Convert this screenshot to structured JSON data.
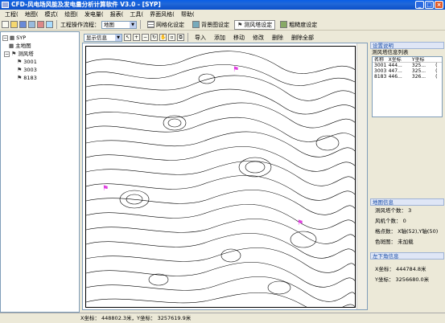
{
  "window": {
    "title": "CFD-风电场风能及发电量分析计算软件 V3.0 - [SYP]",
    "minimize": "_",
    "restore": "□",
    "close": "×"
  },
  "menu": [
    "工程(",
    "地图(",
    "模式(",
    "绘图(",
    "发电量(",
    "报表(",
    "工具(",
    "界面风格(",
    "帮助("
  ],
  "toolbar": {
    "process_label": "工程操作流程：",
    "process_value": "地图",
    "mesh_label": "网格化设定",
    "background_label": "背景图设定",
    "tower_label": "测风塔设定",
    "roughness_label": "粗糙度设定"
  },
  "tree": {
    "root": "SYP",
    "map": "主地图",
    "towers_group": "测风塔",
    "towers": [
      "3001",
      "3003",
      "8183"
    ]
  },
  "map_toolbar": {
    "display_label": "显示信息",
    "import": "导入",
    "add": "添加",
    "move": "移动",
    "edit": "修改",
    "delete": "删除",
    "delete_all": "删除全部"
  },
  "settings_panel": {
    "title": "设置说明",
    "list_title": "测风塔信息列表",
    "columns": [
      "名称",
      "X坐标",
      "Y坐标",
      ""
    ],
    "rows": [
      [
        "3001",
        "444...",
        "325...",
        "("
      ],
      [
        "3003",
        "447...",
        "325...",
        "("
      ],
      [
        "8183",
        "446...",
        "326...",
        "("
      ]
    ]
  },
  "map_info": {
    "title": "地图信息",
    "tower_count": "测风塔个数： 3",
    "turbine_count": "风机个数： 0",
    "grid_points": "格点数： X轴(52),Y轴(50)",
    "color_map": "色斑图： 未加载"
  },
  "lower_left": {
    "title": "左下角信息",
    "x": "X坐标： 444784.8米",
    "y": "Y坐标： 3256680.0米"
  },
  "status": {
    "coords": "X坐标： 448802.3米，Y坐标： 3257619.9米"
  },
  "colors": {
    "tower_flag": "#e040e0",
    "accent": "#1a4ea8"
  }
}
